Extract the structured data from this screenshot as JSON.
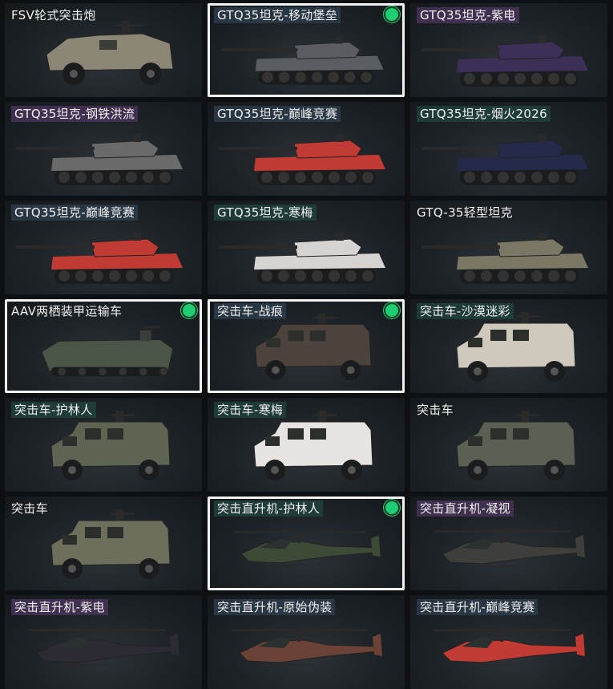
{
  "colors": {
    "tile_background": "#1d2226",
    "selected_border": "#f2f2f2",
    "equipped_dot": "#1fce72"
  },
  "tiles": [
    {
      "label": "FSV轮式突击炮",
      "vehicle": "wheeled-gun-icon",
      "tone": "plain",
      "selected": false,
      "equipped": false
    },
    {
      "label": "GTQ35坦克-移动堡垒",
      "vehicle": "tank-icon",
      "tone": "slate",
      "selected": true,
      "equipped": true
    },
    {
      "label": "GTQ35坦克-紫电",
      "vehicle": "tank-icon",
      "tone": "purple",
      "selected": false,
      "equipped": false
    },
    {
      "label": "GTQ35坦克-钢铁洪流",
      "vehicle": "tank-icon",
      "tone": "purple",
      "selected": false,
      "equipped": false
    },
    {
      "label": "GTQ35坦克-巅峰竞赛",
      "vehicle": "tank-icon",
      "tone": "slate",
      "selected": false,
      "equipped": false
    },
    {
      "label": "GTQ35坦克-烟火2026",
      "vehicle": "tank-icon",
      "tone": "teal",
      "selected": false,
      "equipped": false
    },
    {
      "label": "GTQ35坦克-巅峰竞赛",
      "vehicle": "tank-icon",
      "tone": "slate",
      "selected": false,
      "equipped": false
    },
    {
      "label": "GTQ35坦克-寒梅",
      "vehicle": "tank-icon",
      "tone": "teal",
      "selected": false,
      "equipped": false
    },
    {
      "label": "GTQ-35轻型坦克",
      "vehicle": "tank-icon",
      "tone": "plain",
      "selected": false,
      "equipped": false
    },
    {
      "label": "AAV两栖装甲运输车",
      "vehicle": "amphibious-apc-icon",
      "tone": "plain",
      "selected": true,
      "equipped": true
    },
    {
      "label": "突击车-战痕",
      "vehicle": "armored-truck-icon",
      "tone": "slate",
      "selected": true,
      "equipped": true
    },
    {
      "label": "突击车-沙漠迷彩",
      "vehicle": "armored-truck-icon",
      "tone": "teal",
      "selected": false,
      "equipped": false
    },
    {
      "label": "突击车-护林人",
      "vehicle": "armored-truck-icon",
      "tone": "teal",
      "selected": false,
      "equipped": false
    },
    {
      "label": "突击车-寒梅",
      "vehicle": "armored-truck-icon",
      "tone": "teal",
      "selected": false,
      "equipped": false
    },
    {
      "label": "突击车",
      "vehicle": "armored-truck-icon",
      "tone": "plain",
      "selected": false,
      "equipped": false
    },
    {
      "label": "突击车",
      "vehicle": "armored-truck-icon",
      "tone": "plain",
      "selected": false,
      "equipped": false
    },
    {
      "label": "突击直升机-护林人",
      "vehicle": "helicopter-icon",
      "tone": "teal",
      "selected": true,
      "equipped": true
    },
    {
      "label": "突击直升机-凝视",
      "vehicle": "helicopter-icon",
      "tone": "purple",
      "selected": false,
      "equipped": false
    },
    {
      "label": "突击直升机-紫电",
      "vehicle": "helicopter-icon",
      "tone": "purple",
      "selected": false,
      "equipped": false
    },
    {
      "label": "突击直升机-原始伪装",
      "vehicle": "helicopter-icon",
      "tone": "slate",
      "selected": false,
      "equipped": false
    },
    {
      "label": "突击直升机-巅峰竞赛",
      "vehicle": "helicopter-icon",
      "tone": "slate",
      "selected": false,
      "equipped": false
    }
  ]
}
